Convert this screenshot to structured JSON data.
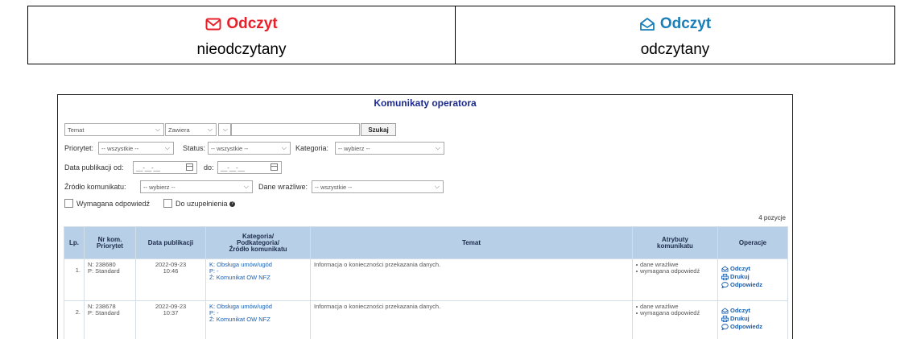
{
  "legend": {
    "unread": {
      "label": "Odczyt",
      "caption": "nieodczytany",
      "color": "#e8202a",
      "icon": "envelope-closed-icon"
    },
    "read": {
      "label": "Odczyt",
      "caption": "odczytany",
      "color": "#1a7fb8",
      "icon": "envelope-open-icon"
    }
  },
  "panel": {
    "title": "Komunikaty operatora",
    "filters": {
      "temat_select": "Temat",
      "zawiera_select": "Zawiera",
      "search_value": "",
      "search_button": "Szukaj",
      "priorytet_label": "Priorytet:",
      "priorytet_value": "-- wszystkie --",
      "status_label": "Status:",
      "status_value": "-- wszystkie --",
      "kategoria_label": "Kategoria:",
      "kategoria_value": "-- wybierz --",
      "data_od_label": "Data publikacji od:",
      "data_od_value": "__-__-__",
      "data_do_label": "do:",
      "data_do_value": "__-__-__",
      "zrodlo_label": "Źródło komunikatu:",
      "zrodlo_value": "-- wybierz --",
      "dane_label": "Dane wrażliwe:",
      "dane_value": "-- wszystkie --",
      "wymagana_label": "Wymagana odpowiedź",
      "uzupelnienie_label": "Do uzupełnienia"
    },
    "count": "4 pozycje",
    "columns": [
      "Lp.",
      "Nr kom.\nPriorytet",
      "Data publikacji",
      "Kategoria/\nPodkategoria/\nŹródło komunikatu",
      "Temat",
      "Atrybuty\nkomunikatu",
      "Operacje"
    ],
    "rows": [
      {
        "lp": "1.",
        "n": "N: 238680",
        "p": "P: Standard",
        "date": "2022-09-23",
        "time": "10:46",
        "k": "K: Obsługa umów/ugód",
        "pp": "P: -",
        "z": "Ź: Komunikat OW NFZ",
        "temat": "Informacja o konieczności przekazania danych.",
        "attr1": "dane wrażliwe",
        "attr2": "wymagana odpowiedź",
        "op1": "Odczyt",
        "op2": "Drukuj",
        "op3": "Odpowiedz"
      },
      {
        "lp": "2.",
        "n": "N: 238678",
        "p": "P: Standard",
        "date": "2022-09-23",
        "time": "10:37",
        "k": "K: Obsługa umów/ugód",
        "pp": "P: -",
        "z": "Ź: Komunikat OW NFZ",
        "temat": "Informacja o konieczności przekazania danych.",
        "attr1": "dane wrażliwe",
        "attr2": "wymagana odpowiedź",
        "op1": "Odczyt",
        "op2": "Drukuj",
        "op3": "Odpowiedz"
      }
    ]
  }
}
